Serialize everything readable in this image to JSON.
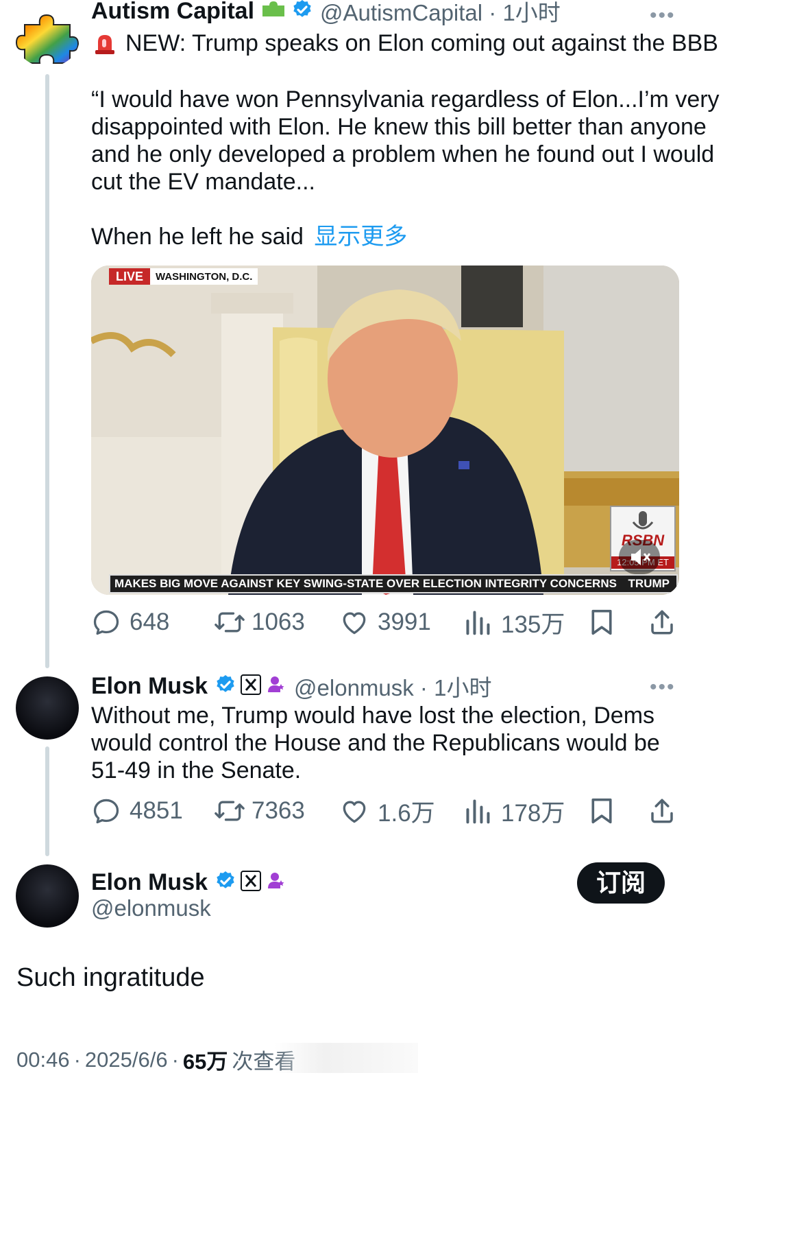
{
  "tweet1": {
    "display_name": "Autism Capital",
    "handle_time": "@AutismCapital · 1小时",
    "headline": "NEW: Trump speaks on Elon coming out against the BBB",
    "body_lines": [
      "“I would have won Pennsylvania regardless of Elon...I’m very",
      "disappointed with Elon. He knew this bill better than anyone",
      "and he only developed a problem when he found out I would",
      "cut the EV mandate..."
    ],
    "last_line": "When he left he said",
    "show_more": "显示更多",
    "video": {
      "live_badge": "LIVE",
      "location": "WASHINGTON, D.C.",
      "ticker": "MAKES BIG MOVE AGAINST KEY SWING-STATE OVER ELECTION INTEGRITY CONCERNS",
      "ticker_name": "TRUMP",
      "network": "RSBN",
      "clock": "12:05 PM ET"
    },
    "stats": {
      "replies": "648",
      "reposts": "1063",
      "likes": "3991",
      "views": "135万"
    }
  },
  "tweet2": {
    "display_name": "Elon Musk",
    "handle_time": "@elonmusk · 1小时",
    "body_lines": [
      "Without me, Trump would have lost the election, Dems",
      "would control the House and the Republicans would be",
      "51-49 in the Senate."
    ],
    "stats": {
      "replies": "4851",
      "reposts": "7363",
      "likes": "1.6万",
      "views": "178万"
    }
  },
  "main": {
    "display_name": "Elon Musk",
    "handle": "@elonmusk",
    "subscribe_label": "订阅",
    "text": "Such ingratitude",
    "time": "00:46",
    "date": "2025/6/6",
    "views_count": "65万",
    "views_suffix": "次查看"
  },
  "colors": {
    "link": "#1d9bf0",
    "verified": "#1d9bf0",
    "text": "#0f1419",
    "muted": "#536471"
  },
  "icons": [
    "reply-icon",
    "repost-icon",
    "like-icon",
    "views-icon",
    "bookmark-icon",
    "share-icon",
    "verified-badge-icon",
    "x-logo-icon",
    "affiliate-icon",
    "more-icon"
  ]
}
